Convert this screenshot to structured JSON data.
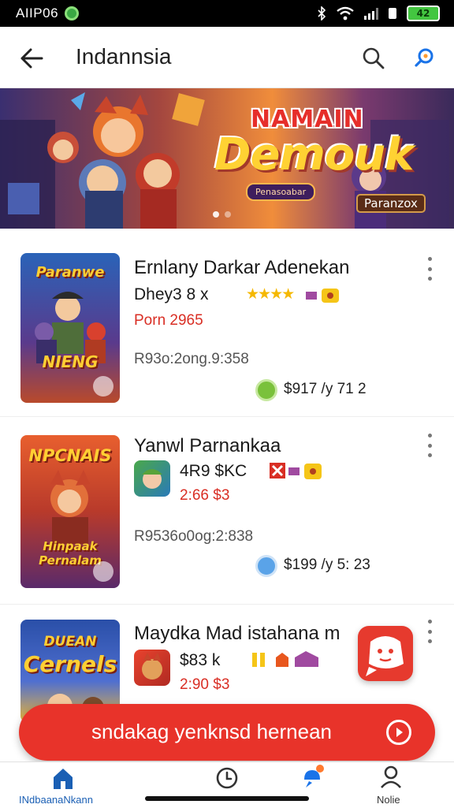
{
  "status_bar": {
    "time": "AIIP06",
    "battery_text": "42"
  },
  "header": {
    "title": "Indannsia"
  },
  "banner": {
    "title_top": "NAMAIN",
    "title_main": "Demouk",
    "subtitle": "Penasoabar",
    "badge": "Paranzox",
    "colors": {
      "accent": "#e62e2a",
      "gold": "#ffd233"
    }
  },
  "apps": [
    {
      "title": "Ernlany Darkar Adenekan",
      "dev": "Dhey3 8 x",
      "rating_stars": "★★★★",
      "sub_red": "Porn 2965",
      "meta": "R93o:2ong.9:358",
      "price": "$917 /y  71 2",
      "thumb_top": "Paranwe",
      "thumb_bottom": "NIENG"
    },
    {
      "title": "Yanwl  Parnankaa",
      "dev": "4R9 $KC",
      "sub_red": "2:66 $3",
      "meta": "R9536o0og:2:838",
      "price": "$199 /y  5: 23",
      "thumb_top": "NPCNAIS",
      "thumb_bottom": "Hinpaak Pernalam"
    },
    {
      "title": "Maydka Mad istahana m",
      "dev": "$83 k",
      "sub_red": "2:90 $3",
      "thumb_top": "DUEAN",
      "thumb_bottom": "Cernels"
    }
  ],
  "cta": {
    "label": "sndakag yenknsd hernean"
  },
  "bottom_nav": {
    "items": [
      {
        "label": "INdbaanaNkann",
        "icon": "home-icon",
        "active": true
      },
      {
        "label": "",
        "icon": "clock-icon",
        "active": false
      },
      {
        "label": "",
        "icon": "notification-icon",
        "active": false
      },
      {
        "label": "Nolie",
        "icon": "profile-icon",
        "active": false
      }
    ]
  }
}
